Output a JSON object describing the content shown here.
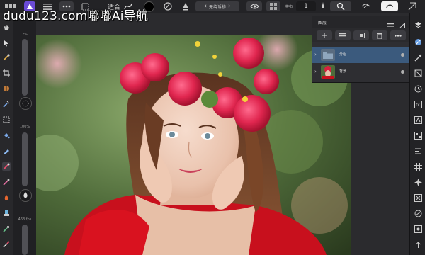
{
  "topbar": {
    "zoom_label": "适合",
    "blend_mode": "无绕诉移",
    "param_label": "排布",
    "param_value": "1"
  },
  "watermark": "dudu123.com嘟嘟Ai导航",
  "context": {
    "opacity_label": "2%",
    "size_label": "100%",
    "flow_label": "463 fps"
  },
  "layers_panel": {
    "title": "图层",
    "layers": [
      {
        "name": "分组",
        "type": "group",
        "selected": true
      },
      {
        "name": "背景",
        "type": "pixel",
        "selected": false
      }
    ]
  },
  "colors": {
    "accent": "#4a90e2",
    "selection": "#3b5a7d",
    "ui_dark": "#232326"
  }
}
